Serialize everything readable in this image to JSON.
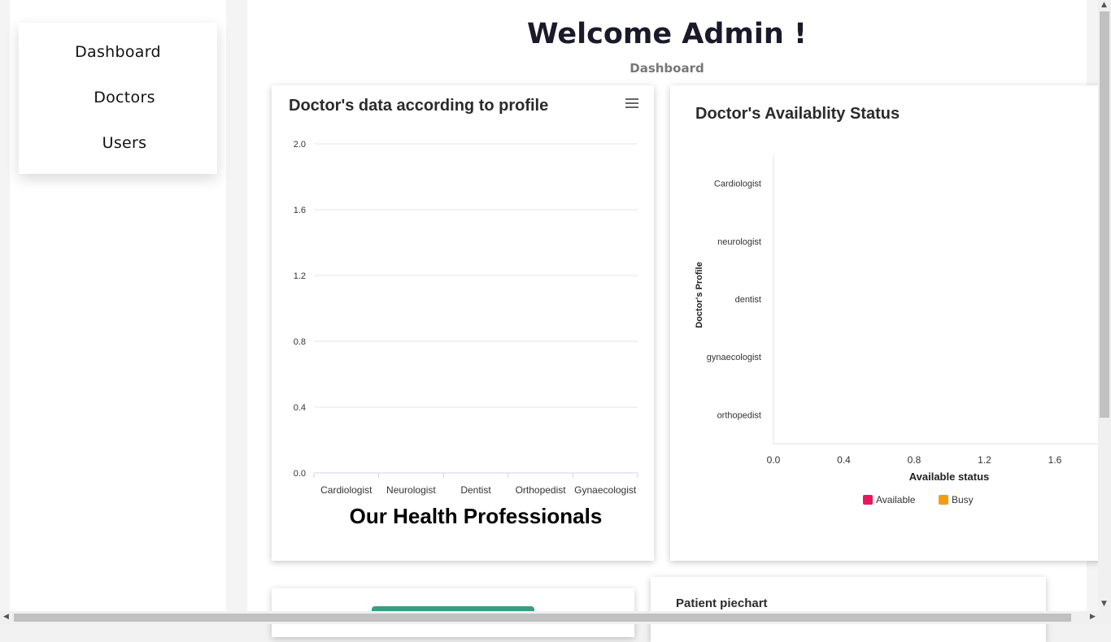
{
  "sidebar": {
    "items": [
      {
        "label": "Dashboard"
      },
      {
        "label": "Doctors"
      },
      {
        "label": "Users"
      }
    ]
  },
  "header": {
    "title": "Welcome Admin !",
    "subtitle": "Dashboard"
  },
  "card1": {
    "title": "Doctor's data according to profile",
    "menu_icon": "hamburger-menu-icon",
    "footer": "Our Health Professionals"
  },
  "card2": {
    "title": "Doctor's Availablity Status"
  },
  "card4": {
    "title": "Patient piechart"
  },
  "chart_data": [
    {
      "type": "bar",
      "title": "Doctor's data according to profile",
      "categories": [
        "Cardiologist",
        "Neurologist",
        "Dentist",
        "Orthopedist",
        "Gynaecologist"
      ],
      "values": [
        0,
        0,
        0,
        0,
        0
      ],
      "ylim": [
        0,
        2
      ],
      "yticks": [
        "2.0",
        "1.6",
        "1.2",
        "0.8",
        "0.4",
        "0.0"
      ],
      "grid": true
    },
    {
      "type": "bar",
      "orientation": "horizontal",
      "title": "Doctor's Availablity Status",
      "categories": [
        "Cardiologist",
        "neurologist",
        "dentist",
        "gynaecologist",
        "orthopedist"
      ],
      "xticks": [
        "0.0",
        "0.4",
        "0.8",
        "1.2",
        "1.6"
      ],
      "xlim": [
        0,
        1.8
      ],
      "xlabel": "Available status",
      "ylabel": "Doctor's Profile",
      "series": [
        {
          "name": "Available",
          "values": [
            0,
            0,
            0,
            0,
            0
          ],
          "color": "#e8175d"
        },
        {
          "name": "Busy",
          "values": [
            0,
            0,
            0,
            0,
            0
          ],
          "color": "#f39c12"
        }
      ],
      "legend": "bottom"
    }
  ]
}
